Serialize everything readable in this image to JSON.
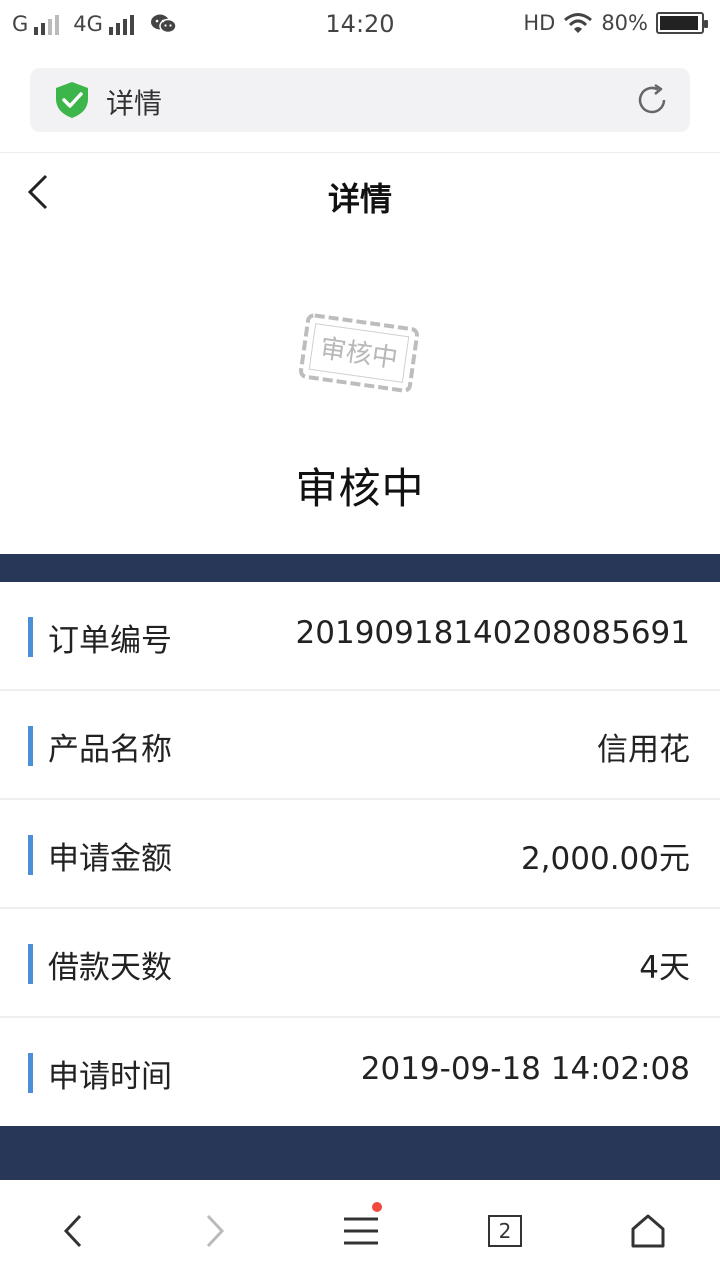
{
  "status_bar": {
    "carrier1": "G",
    "carrier2": "4G",
    "time": "14:20",
    "hd": "HD",
    "battery": "80%"
  },
  "browser": {
    "url_title": "详情",
    "tab_count": "2"
  },
  "header": {
    "title": "详情"
  },
  "stamp": {
    "text": "审核中"
  },
  "order": {
    "status": "审核中",
    "rows": [
      {
        "label": "订单编号",
        "value": "20190918140208085691"
      },
      {
        "label": "产品名称",
        "value": "信用花"
      },
      {
        "label": "申请金额",
        "value": "2,000.00元"
      },
      {
        "label": "借款天数",
        "value": "4天"
      },
      {
        "label": "申请时间",
        "value": "2019-09-18 14:02:08"
      }
    ]
  },
  "colors": {
    "accent_bar": "#4a90d9",
    "band": "#283657",
    "shield": "#3cb64a",
    "badge": "#f04a3e"
  },
  "icons": [
    "signal-icon",
    "wechat-icon",
    "wifi-icon",
    "battery-icon",
    "shield-check-icon",
    "reload-icon",
    "back-icon",
    "stamp-icon",
    "nav-back-icon",
    "nav-forward-icon",
    "menu-icon",
    "tabs-icon",
    "home-icon"
  ]
}
